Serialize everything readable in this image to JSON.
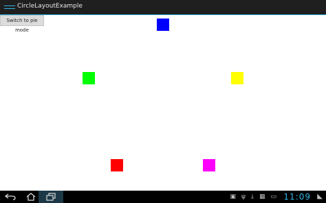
{
  "app": {
    "title": "CircleLayoutExample"
  },
  "content": {
    "mode_button_label": "Switch to pie mode"
  },
  "squares": [
    {
      "name": "blue",
      "color": "#0000ff"
    },
    {
      "name": "green",
      "color": "#00ff00"
    },
    {
      "name": "yellow",
      "color": "#ffff00"
    },
    {
      "name": "red",
      "color": "#ff0000"
    },
    {
      "name": "magenta",
      "color": "#ff00ff"
    }
  ],
  "system_bar": {
    "time": "11:09",
    "icons": [
      "back-icon",
      "home-icon",
      "recent-apps-icon",
      "gallery-icon",
      "usb-icon",
      "download-icon",
      "calendar-icon",
      "image-icon",
      "wifi-icon"
    ],
    "accent_color": "#33b5e5"
  }
}
